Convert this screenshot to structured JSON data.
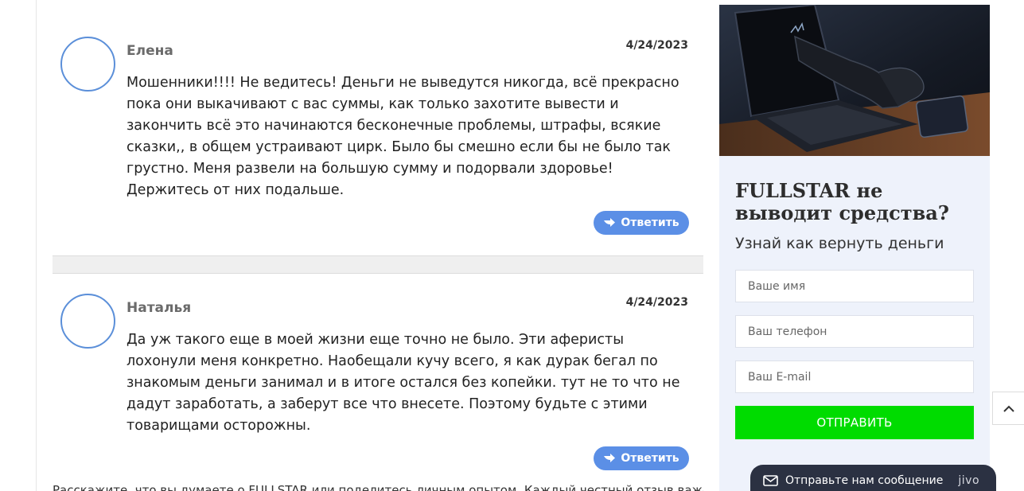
{
  "comments": [
    {
      "author": "Елена",
      "date": "4/24/2023",
      "text": "Мошенники!!!! Не ведитесь! Деньги не выведутся никогда, всё прекрасно пока они выкачивают с вас суммы, как только захотите вывести и закончить всё это начинаются бесконечные проблемы, штрафы, всякие сказки,, в общем устраивают цирк. Было бы смешно если бы не было так грустно. Меня развели на большую сумму и подорвали здоровье! Держитесь от них подальше.",
      "reply_label": "Ответить"
    },
    {
      "author": "Наталья",
      "date": "4/24/2023",
      "text": "Да уж такого еще в моей жизни еще точно не было. Эти аферисты лохонули меня конкретно. Наобещали кучу всего, я как дурак бегал по знакомым деньги занимал и в итоге остался без копейки. тут не то что не дадут заработать, а заберут все что внесете. Поэтому будьте с этими товарищами осторожны.",
      "reply_label": "Ответить"
    }
  ],
  "bottom_text": "Расскажите, что вы думаете о FULLSTAR или поделитесь личным опытом. Каждый честный отзыв важен",
  "sidebar": {
    "title": "FULLSTAR не выводит средства?",
    "subtitle": "Узнай как вернуть деньги",
    "name_placeholder": "Ваше имя",
    "phone_placeholder": "Ваш телефон",
    "email_placeholder": "Ваш E-mail",
    "submit_label": "Отправить"
  },
  "chat": {
    "label": "Отправьте нам сообщение",
    "brand": "jivo"
  },
  "colors": {
    "accent_blue": "#5b8fe6",
    "submit_green": "#00dc00",
    "sidebar_bg": "#eef2fb",
    "chat_bg": "#2b3142"
  }
}
